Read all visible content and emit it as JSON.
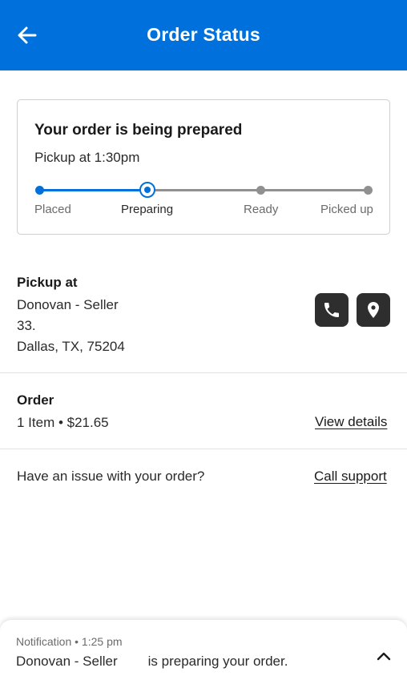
{
  "header": {
    "title": "Order Status",
    "back_icon": "arrow-left-icon",
    "color": "#0071dc"
  },
  "status_card": {
    "title": "Your order is being prepared",
    "pickup_time": "Pickup at 1:30pm",
    "steps": [
      {
        "label": "Placed",
        "state": "done"
      },
      {
        "label": "Preparing",
        "state": "current"
      },
      {
        "label": "Ready",
        "state": "pending"
      },
      {
        "label": "Picked up",
        "state": "pending"
      }
    ]
  },
  "pickup": {
    "label": "Pickup at",
    "store": "Donovan - Seller",
    "address_line1": "33.",
    "address_line2": "Dallas, TX, 75204",
    "phone_icon": "phone-icon",
    "map_icon": "location-pin-icon"
  },
  "order": {
    "label": "Order",
    "summary": "1 Item • $21.65",
    "details_link": "View details"
  },
  "support": {
    "question": "Have an issue with your order?",
    "link": "Call support"
  },
  "notification": {
    "meta": "Notification • 1:25 pm",
    "store": "Donovan - Seller",
    "message": "is preparing your order.",
    "chevron_icon": "chevron-up-icon"
  }
}
